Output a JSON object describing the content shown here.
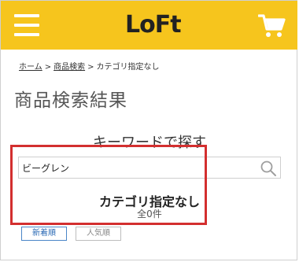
{
  "header": {
    "logo": "LoFt",
    "bg_color": "#f6c51d",
    "menu_icon": "hamburger-menu-icon",
    "cart_icon": "shopping-cart-icon"
  },
  "breadcrumb": {
    "items": [
      "ホーム",
      "商品検索",
      "カテゴリ指定なし"
    ],
    "separator": ">"
  },
  "page_title": "商品検索結果",
  "keyword_heading": "キーワードで探す",
  "search": {
    "value": "ビーグレン",
    "icon": "search-icon"
  },
  "result": {
    "category": "カテゴリ指定なし",
    "count_text": "全0件"
  },
  "sort": {
    "new_label": "新着順",
    "popular_label": "人気順"
  },
  "highlight_color": "#d32f2f"
}
